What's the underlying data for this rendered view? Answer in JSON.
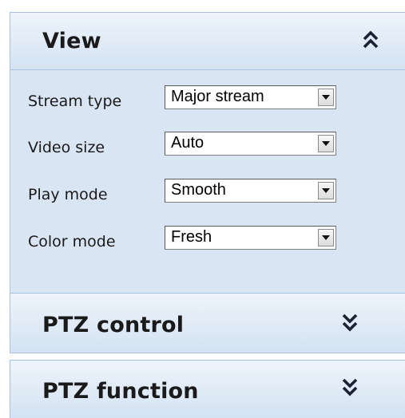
{
  "view_panel": {
    "title": "View",
    "toggle_icon": "double-chevron-up-icon",
    "fields": [
      {
        "label": "Stream type",
        "value": "Major stream"
      },
      {
        "label": "Video size",
        "value": "Auto"
      },
      {
        "label": "Play mode",
        "value": "Smooth"
      },
      {
        "label": "Color mode",
        "value": "Fresh"
      }
    ]
  },
  "ptz_control_panel": {
    "title": "PTZ control",
    "toggle_icon": "double-chevron-down-icon"
  },
  "ptz_function_panel": {
    "title": "PTZ function",
    "toggle_icon": "double-chevron-down-icon"
  },
  "colors": {
    "header_gradient_top": "#eef4fb",
    "header_gradient_bottom": "#d3e2f2",
    "panel_body": "#d9e5f2",
    "border": "#a9c2dc",
    "chevron": "#1a2233"
  }
}
